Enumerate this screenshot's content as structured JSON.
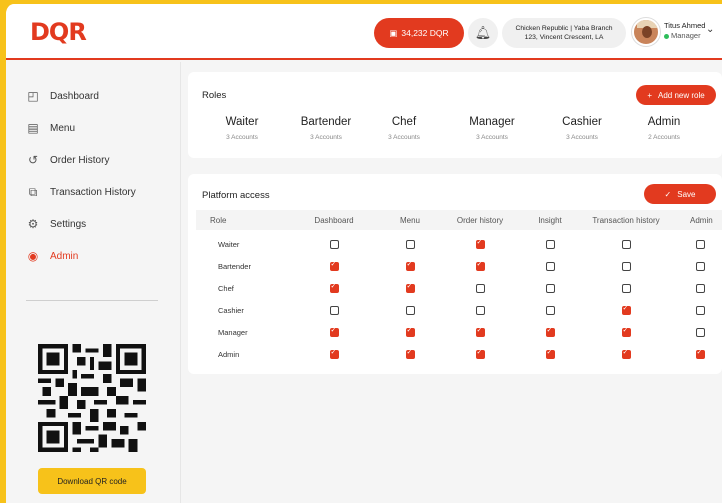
{
  "header": {
    "logo": "DQR",
    "balance": "34,232 DQR",
    "branch_line1": "Chicken Republic | Yaba Branch",
    "branch_line2": "123, Vincent Crescent, LA",
    "user_name": "Titus Ahmed",
    "user_role": "Manager"
  },
  "sidebar": {
    "items": [
      {
        "label": "Dashboard",
        "icon": "dashboard-icon"
      },
      {
        "label": "Menu",
        "icon": "menu-icon"
      },
      {
        "label": "Order History",
        "icon": "history-icon"
      },
      {
        "label": "Transaction History",
        "icon": "transaction-icon"
      },
      {
        "label": "Settings",
        "icon": "settings-icon"
      },
      {
        "label": "Admin",
        "icon": "admin-icon",
        "active": true
      }
    ],
    "download_label": "Download QR code"
  },
  "roles": {
    "title": "Roles",
    "add_label": "Add new role",
    "items": [
      {
        "name": "Waiter",
        "accounts": "3 Accounts"
      },
      {
        "name": "Bartender",
        "accounts": "3 Accounts"
      },
      {
        "name": "Chef",
        "accounts": "3 Accounts"
      },
      {
        "name": "Manager",
        "accounts": "3 Accounts"
      },
      {
        "name": "Cashier",
        "accounts": "3 Accounts"
      },
      {
        "name": "Admin",
        "accounts": "2 Accounts"
      }
    ]
  },
  "access": {
    "title": "Platform access",
    "save_label": "Save",
    "columns": [
      "Role",
      "Dashboard",
      "Menu",
      "Order history",
      "Insight",
      "Transaction history",
      "Admin"
    ],
    "rows": [
      {
        "role": "Waiter",
        "perms": [
          false,
          false,
          true,
          false,
          false,
          false
        ]
      },
      {
        "role": "Bartender",
        "perms": [
          true,
          true,
          true,
          false,
          false,
          false
        ]
      },
      {
        "role": "Chef",
        "perms": [
          true,
          true,
          false,
          false,
          false,
          false
        ]
      },
      {
        "role": "Cashier",
        "perms": [
          false,
          false,
          false,
          false,
          true,
          false
        ]
      },
      {
        "role": "Manager",
        "perms": [
          true,
          true,
          true,
          true,
          true,
          false
        ]
      },
      {
        "role": "Admin",
        "perms": [
          true,
          true,
          true,
          true,
          true,
          true
        ]
      }
    ]
  },
  "colors": {
    "accent": "#e23a1f",
    "brand_yellow": "#f7c21a"
  }
}
